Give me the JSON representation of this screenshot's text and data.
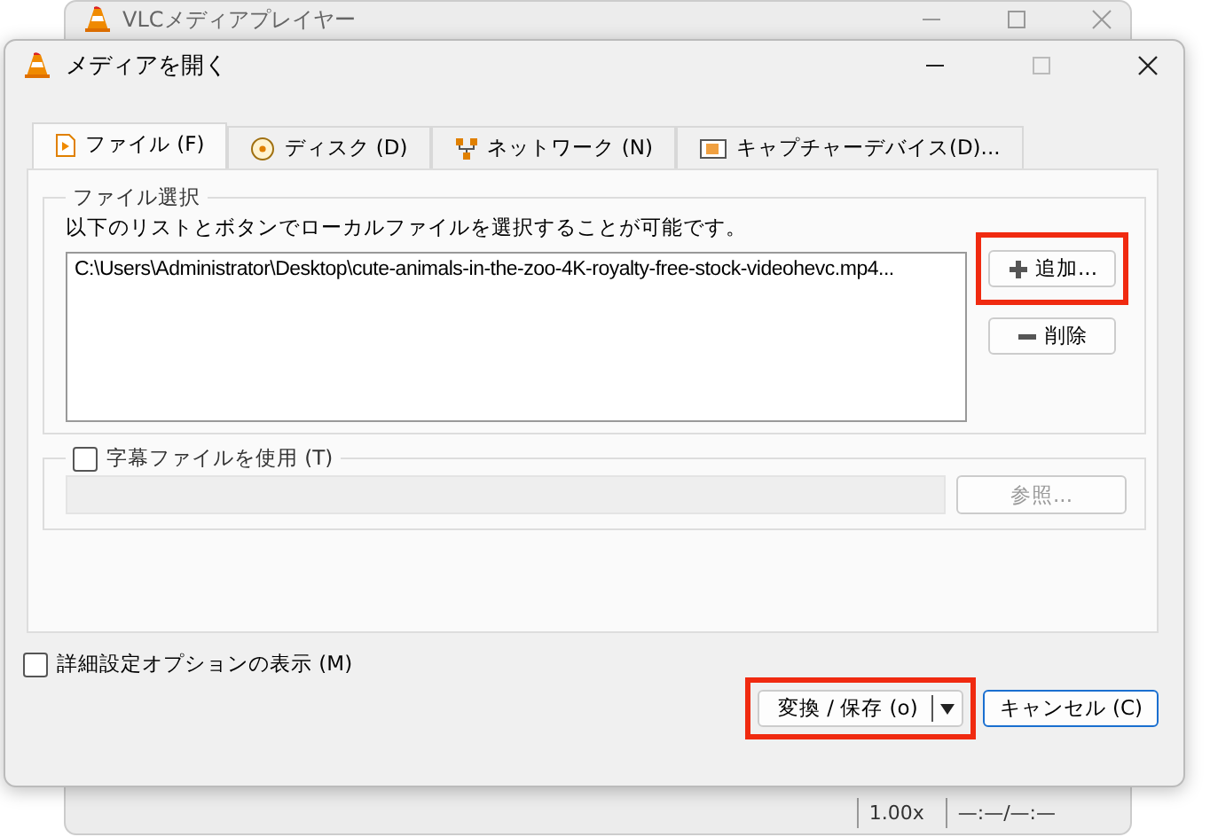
{
  "background_window": {
    "title": "VLCメディアプレイヤー",
    "status": [
      "1.00x",
      "—:—/—:—"
    ]
  },
  "dialog": {
    "title": "メディアを開く"
  },
  "tabs": [
    {
      "label": "ファイル (F)",
      "selected": true,
      "kind": "file"
    },
    {
      "label": "ディスク (D)",
      "selected": false,
      "kind": "disc"
    },
    {
      "label": "ネットワーク (N)",
      "selected": false,
      "kind": "network"
    },
    {
      "label": "キャプチャーデバイス(D)...",
      "selected": false,
      "kind": "capture"
    }
  ],
  "file_selection": {
    "title": "ファイル選択",
    "description": "以下のリストとボタンでローカルファイルを選択することが可能です。",
    "files": [
      "C:\\Users\\Administrator\\Desktop\\cute-animals-in-the-zoo-4K-royalty-free-stock-videohevc.mp4..."
    ],
    "add_button": {
      "label": "追加...",
      "highlighted": true
    },
    "remove_button": {
      "label": "削除"
    }
  },
  "subtitles": {
    "label": "字幕ファイルを使用 (T)",
    "checked": false,
    "browse_button": "参照..."
  },
  "advanced_options": {
    "label": "詳細設定オプションの表示 (M)",
    "checked": false
  },
  "convert_button": {
    "label": "変換 / 保存 (o)",
    "highlighted": true
  },
  "cancel_button": {
    "label": "キャンセル (C)"
  }
}
